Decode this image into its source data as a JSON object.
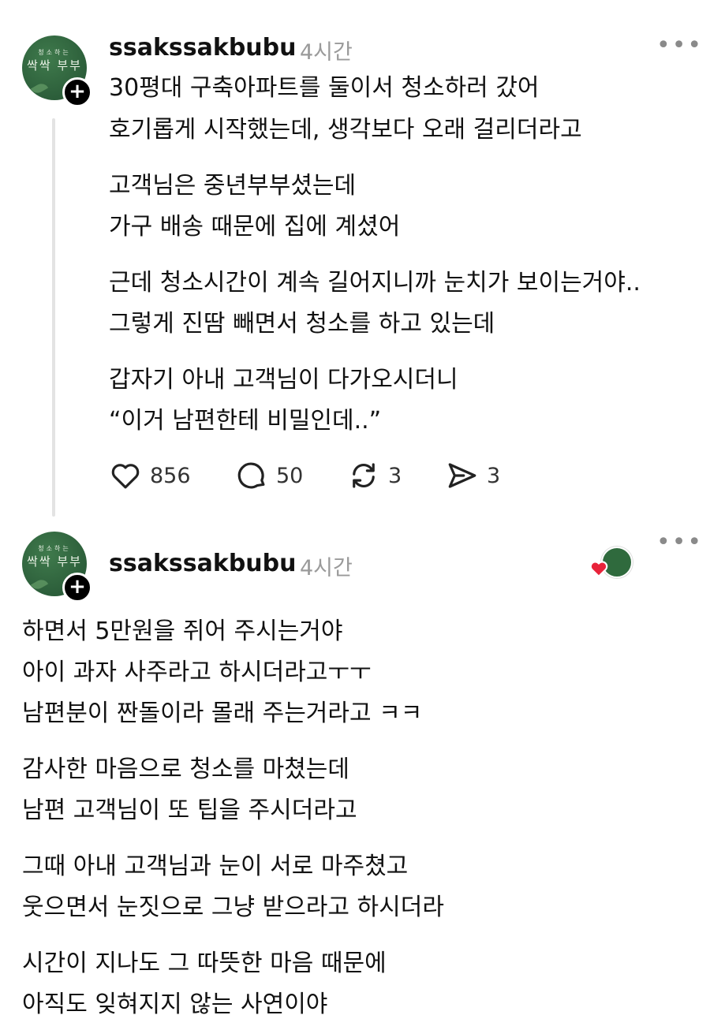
{
  "post1": {
    "avatar_top": "청소하는",
    "avatar_big": "싹싹 부부",
    "username": "ssakssakbubu",
    "time": "4시간",
    "lines": [
      "30평대 구축아파트를 둘이서 청소하러 갔어",
      "호기롭게 시작했는데, 생각보다 오래 걸리더라고",
      "고객님은 중년부부셨는데",
      "가구 배송 때문에 집에 계셨어",
      "근데 청소시간이 계속 길어지니까 눈치가 보이는거야..",
      "그렇게 진땀 빼면서 청소를 하고 있는데",
      "갑자기 아내 고객님이 다가오시더니",
      "“이거 남편한테 비밀인데..”"
    ],
    "likes": "856",
    "comments": "50",
    "reposts": "3",
    "shares": "3"
  },
  "post2": {
    "avatar_top": "청소하는",
    "avatar_big": "싹싹 부부",
    "username": "ssakssakbubu",
    "time": "4시간",
    "lines": [
      "하면서 5만원을 쥐어 주시는거야",
      "아이 과자 사주라고 하시더라고ㅜㅜ",
      "남편분이 짠돌이라 몰래 주는거라고 ㅋㅋ",
      "감사한 마음으로 청소를 마쳤는데",
      "남편 고객님이 또 팁을 주시더라고",
      "그때 아내 고객님과 눈이 서로 마주쳤고",
      "웃으면서 눈짓으로 그냥 받으라고 하시더라",
      "시간이 지나도 그 따뜻한 마음 때문에",
      "아직도 잊혀지지 않는 사연이야"
    ]
  },
  "icons": {
    "like": "heart-icon",
    "comment": "comment-icon",
    "repost": "repost-icon",
    "share": "send-icon",
    "more": "more-icon",
    "follow": "plus-icon"
  },
  "colors": {
    "avatar_green": "#2c5e3a",
    "liked_heart": "#e8233a",
    "muted": "#9a9a9a"
  }
}
